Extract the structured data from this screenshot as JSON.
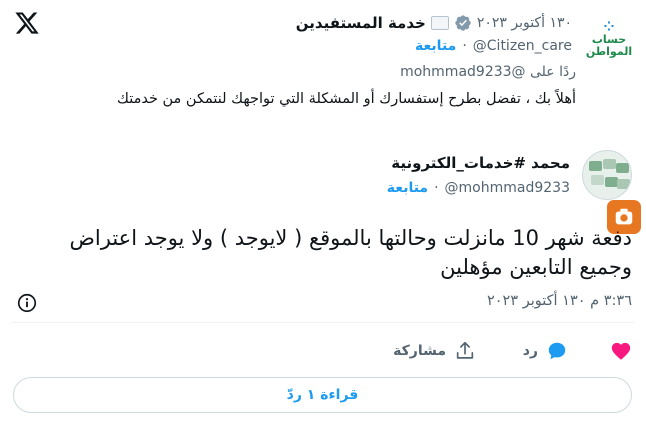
{
  "reply": {
    "display_name": "خدمة المستفيدين",
    "date": "١٣٠ أكتوبر ٢٠٢٣",
    "handle": "@Citizen_care",
    "follow_label": "متابعة",
    "replying_to": "ردًا على @mohmmad9233",
    "text": "أهلاً بك ، تفضل بطرح إستفسارك أو المشكلة التي تواجهك لنتمكن من خدمتك",
    "avatar_text_line1": "حساب",
    "avatar_text_line2": "المواطن"
  },
  "tweet": {
    "author_name": "محمد #خدمات_الكترونية",
    "handle": "@mohmmad9233",
    "follow_label": "متابعة",
    "text": "دفعة شهر 10 مانزلت وحالتها بالموقع ( لايوجد ) ولا يوجد اعتراض وجميع التابعين مؤهلين",
    "timestamp": "٣:٣٦ م ١٣٠ أكتوبر ٢٠٢٣"
  },
  "actions": {
    "reply_label": "رد",
    "share_label": "مشاركة"
  },
  "read_replies_label": "قراءة ١ ردّ",
  "colors": {
    "accent": "#1d9bf0",
    "like": "#f91880",
    "muted": "#536471"
  }
}
